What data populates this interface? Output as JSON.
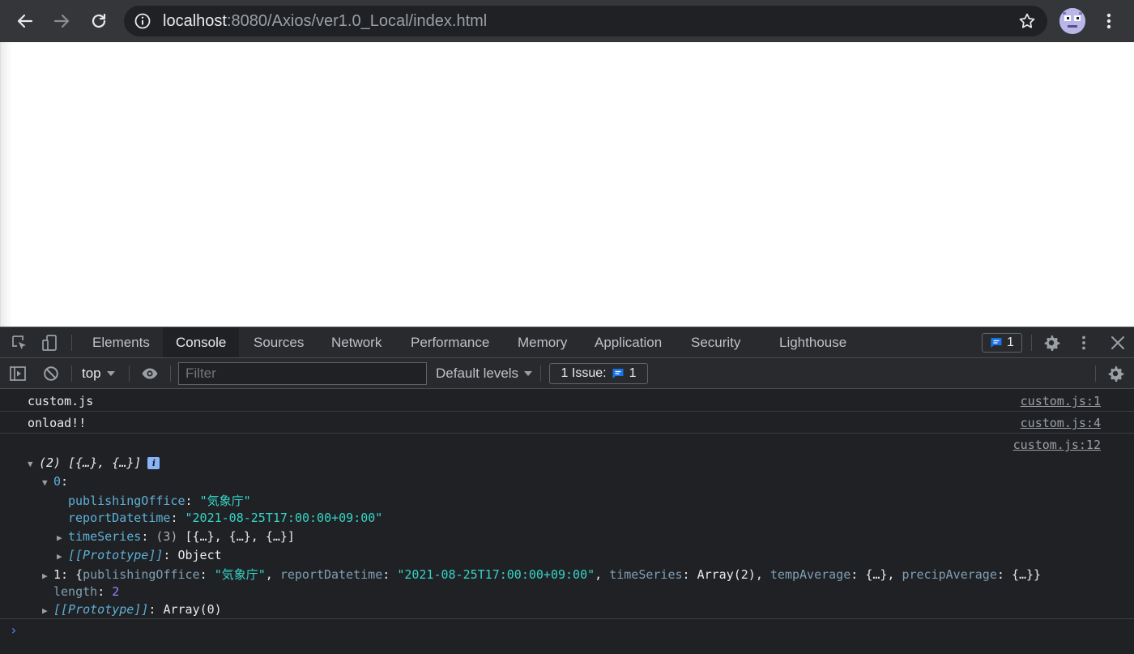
{
  "browser": {
    "url_host": "localhost",
    "url_path": ":8080/Axios/ver1.0_Local/index.html"
  },
  "devtools": {
    "tabs": [
      "Elements",
      "Console",
      "Sources",
      "Network",
      "Performance",
      "Memory",
      "Application",
      "Security",
      "Lighthouse"
    ],
    "active_tab": "Console",
    "issues_count": "1"
  },
  "console_bar": {
    "context": "top",
    "filter_placeholder": "Filter",
    "levels": "Default levels",
    "issues_label": "1 Issue:",
    "issues_count": "1"
  },
  "messages": [
    {
      "text": "custom.js",
      "source": "custom.js:1"
    },
    {
      "text": "onload!!",
      "source": "custom.js:4"
    }
  ],
  "object_log": {
    "source": "custom.js:12",
    "summary": "(2) [{…}, {…}]",
    "info_badge": "i",
    "item0_key": "0",
    "publishingOffice_key": "publishingOffice",
    "publishingOffice_val": "\"気象庁\"",
    "reportDatetime_key": "reportDatetime",
    "reportDatetime_val": "\"2021-08-25T17:00:00+09:00\"",
    "timeSeries_key": "timeSeries",
    "timeSeries_count": "(3)",
    "timeSeries_val": "[{…}, {…}, {…}]",
    "prototype_key": "[[Prototype]]",
    "prototype_obj": "Object",
    "item1_key": "1",
    "item1_pub_key": "publishingOffice",
    "item1_pub_val": "\"気象庁\"",
    "item1_rep_key": "reportDatetime",
    "item1_rep_val": "\"2021-08-25T17:00:00+09:00\"",
    "item1_ts_key": "timeSeries",
    "item1_ts_val": "Array(2)",
    "item1_temp_key": "tempAverage",
    "item1_temp_val": "{…}",
    "item1_precip_key": "precipAverage",
    "item1_precip_val": "{…}",
    "length_key": "length",
    "length_val": "2",
    "proto_arr_key": "[[Prototype]]",
    "proto_arr_val": "Array(0)"
  },
  "icons": [
    "back-icon",
    "forward-icon",
    "reload-icon",
    "info-icon",
    "star-icon",
    "avatar",
    "more-icon",
    "inspect-icon",
    "device-toolbar-icon",
    "message-icon",
    "settings-icon",
    "close-icon",
    "sidebar-icon",
    "clear-icon",
    "eye-icon",
    "prompt-icon"
  ],
  "colors": {
    "toolbar_bg": "#35363a",
    "devtools_bg": "#202124",
    "string": "#35d4c7",
    "key": "#5db0d7",
    "number": "#9980ff",
    "accent_blue": "#1a73e8"
  }
}
